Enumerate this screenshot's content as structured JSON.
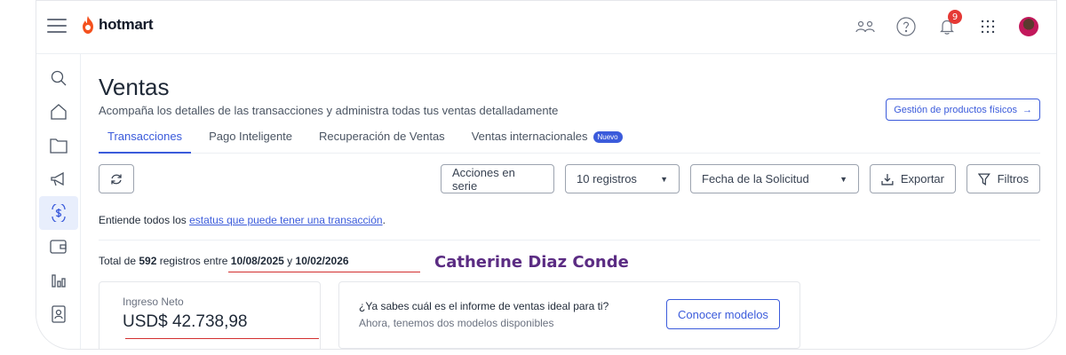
{
  "header": {
    "logo_text": "hotmart",
    "notification_count": "9",
    "icons": [
      "users-icon",
      "help-icon",
      "bell-icon",
      "apps-grid-icon",
      "avatar"
    ]
  },
  "sidebar": {
    "items": [
      {
        "name": "search-icon",
        "active": false
      },
      {
        "name": "home-icon",
        "active": false
      },
      {
        "name": "folder-icon",
        "active": false
      },
      {
        "name": "megaphone-icon",
        "active": false
      },
      {
        "name": "sales-icon",
        "active": true
      },
      {
        "name": "wallet-icon",
        "active": false
      },
      {
        "name": "analytics-icon",
        "active": false
      },
      {
        "name": "contacts-icon",
        "active": false
      }
    ]
  },
  "page": {
    "title": "Ventas",
    "subtitle": "Acompaña los detalles de las transacciones y administra todas tus ventas detalladamente",
    "physical_products_button": "Gestión de productos físicos"
  },
  "tabs": [
    {
      "label": "Transacciones",
      "active": true
    },
    {
      "label": "Pago Inteligente",
      "active": false
    },
    {
      "label": "Recuperación de Ventas",
      "active": false
    },
    {
      "label": "Ventas internacionales",
      "active": false,
      "badge": "Nuevo"
    }
  ],
  "toolbar": {
    "bulk_actions": "Acciones en serie",
    "records_select": "10 registros",
    "date_select": "Fecha de la Solicitud",
    "export": "Exportar",
    "filters": "Filtros"
  },
  "info": {
    "prefix": "Entiende todos los ",
    "link": "estatus que puede tener una transacción",
    "suffix": "."
  },
  "summary": {
    "total_prefix": "Total de ",
    "count": "592",
    "between": " registros entre ",
    "date_from": "10/08/2025",
    "and": " y ",
    "date_to": "10/02/2026",
    "name_overlay": "Catherine Diaz Conde"
  },
  "revenue_card": {
    "label": "Ingreso Neto",
    "value": "USD$ 42.738,98"
  },
  "promo_card": {
    "question": "¿Ya sabes cuál es el informe de ventas ideal para ti?",
    "subtitle": "Ahora, tenemos dos modelos disponibles",
    "button": "Conocer modelos"
  },
  "colors": {
    "accent": "#3b5bdb",
    "brand": "#f4511e",
    "highlight_name": "#5b2c83",
    "annotation_red": "#d32f2f"
  }
}
